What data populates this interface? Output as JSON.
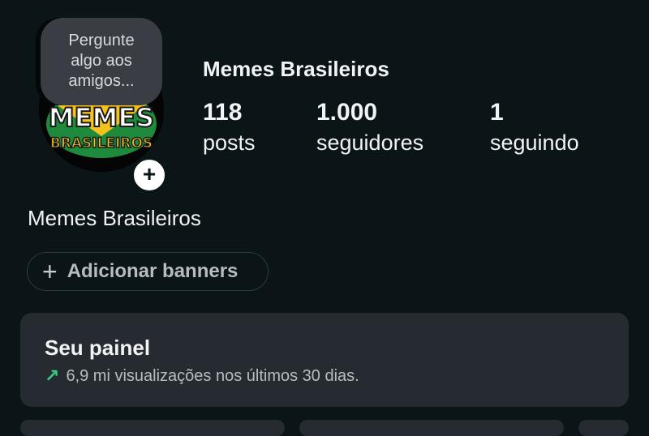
{
  "profile": {
    "note": [
      "Pergunte",
      "algo aos",
      "amigos..."
    ],
    "avatar_text": [
      "MEMES",
      "BRASILEIROS"
    ],
    "add_story_symbol": "+",
    "username": "Memes Brasileiros",
    "stats": {
      "posts": {
        "value": "118",
        "label": "posts"
      },
      "followers": {
        "value": "1.000",
        "label": "seguidores"
      },
      "following": {
        "value": "1",
        "label": "seguindo"
      }
    },
    "display_name": "Memes Brasileiros"
  },
  "banner_button": {
    "icon": "plus-icon",
    "label": "Adicionar banners"
  },
  "dashboard": {
    "title": "Seu painel",
    "icon": "trend-up-arrow-icon",
    "subtitle": "6,9 mi visualizações nos últimos 30 dias."
  },
  "colors": {
    "background": "#0b1416",
    "card": "#262b31",
    "accent_green": "#35d07f",
    "text_primary": "#f1f3f4",
    "text_secondary": "#b8bcc0"
  }
}
